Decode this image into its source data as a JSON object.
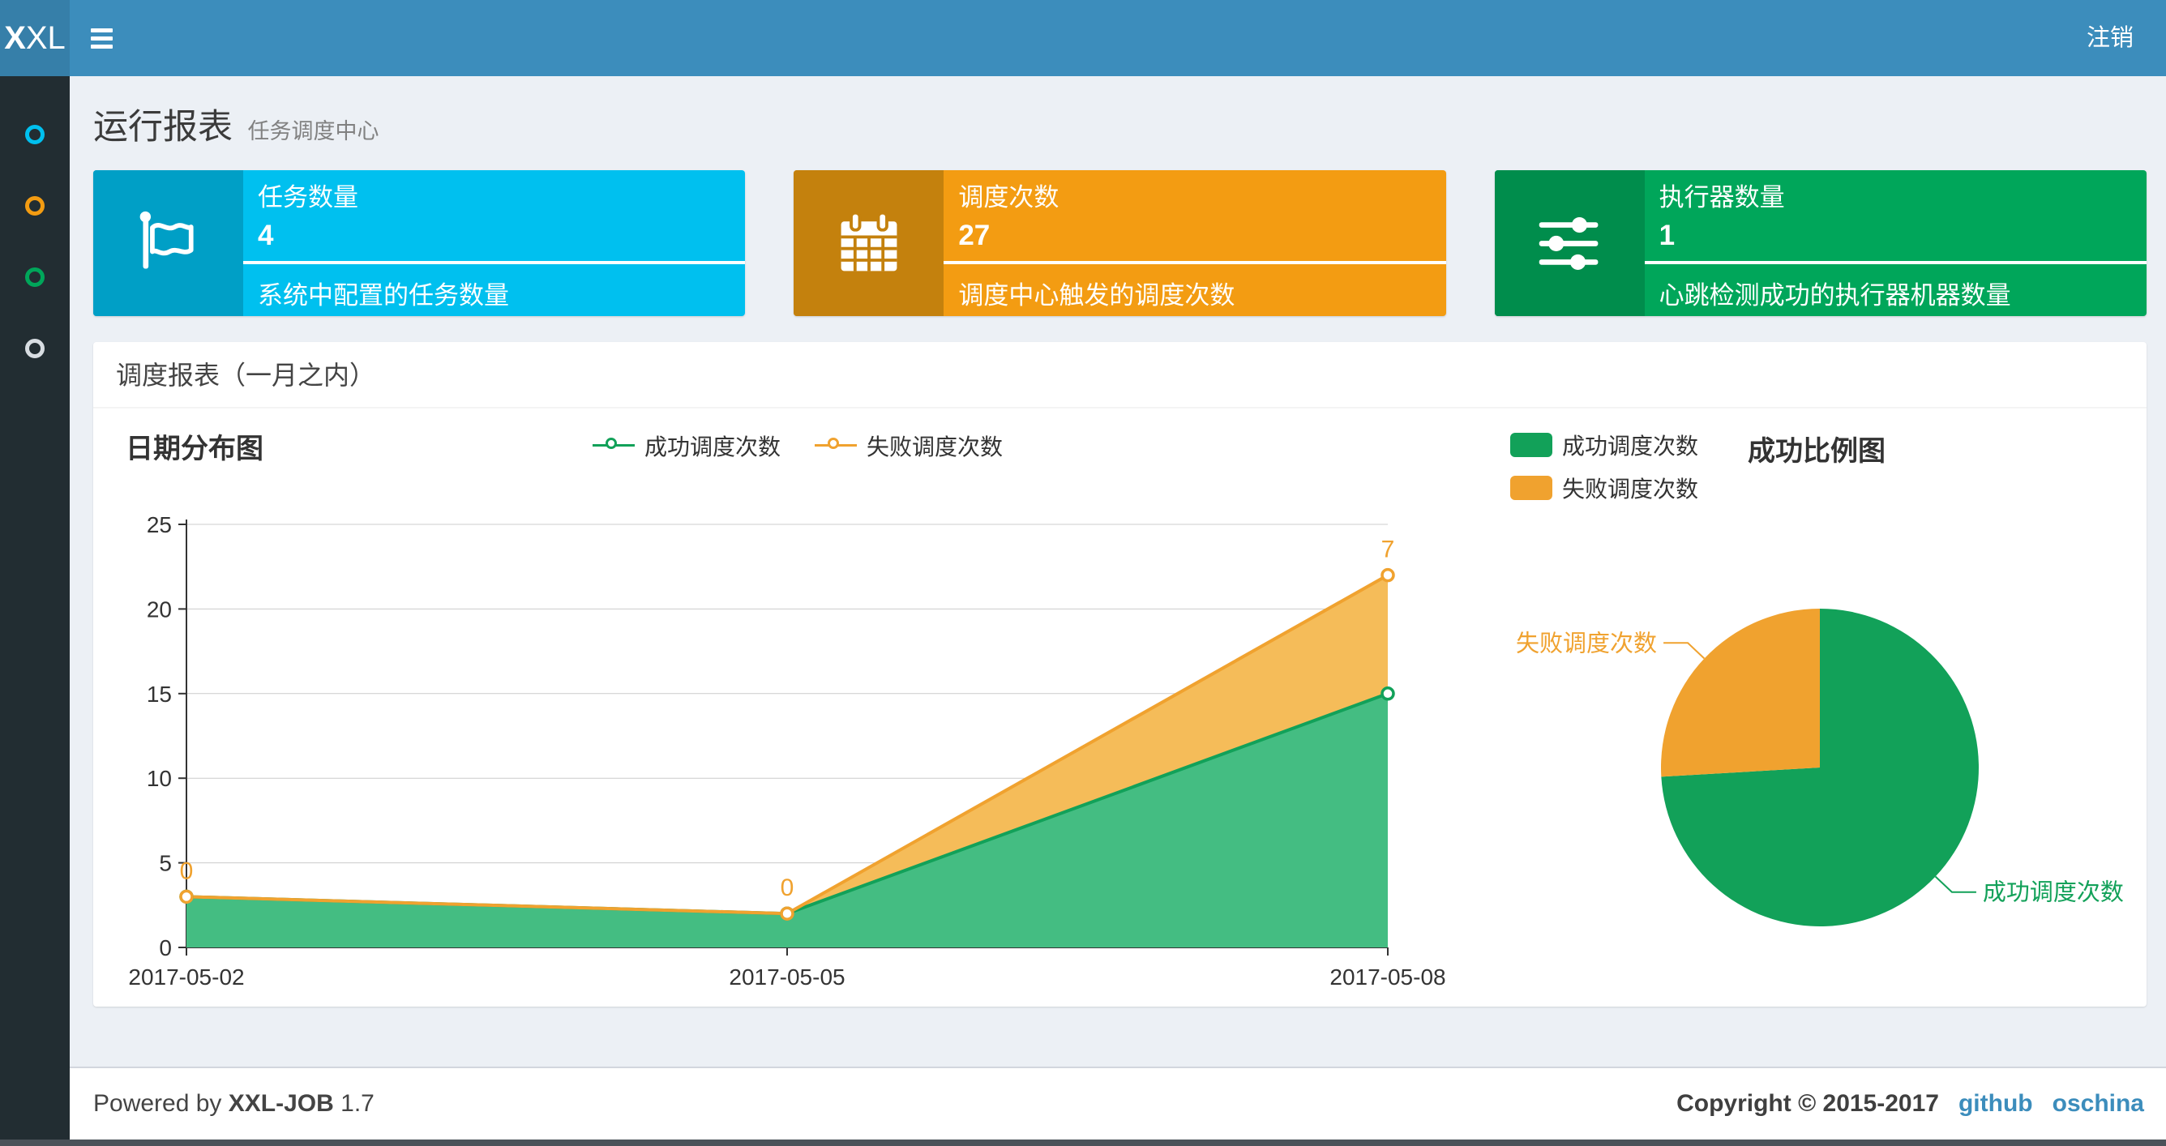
{
  "navbar": {
    "logo_bold": "X",
    "logo_light": "XL",
    "logout_label": "注销"
  },
  "sidebar": {
    "items": [
      {
        "icon": "circle-outline",
        "color": "#00c0ef"
      },
      {
        "icon": "circle-outline",
        "color": "#f39c12"
      },
      {
        "icon": "circle-outline",
        "color": "#00a65a"
      },
      {
        "icon": "circle-outline",
        "color": "#d8dde2"
      }
    ]
  },
  "page_header": {
    "title": "运行报表",
    "subtitle": "任务调度中心"
  },
  "info_boxes": [
    {
      "label": "任务数量",
      "value": "4",
      "desc": "系统中配置的任务数量",
      "icon": "flag",
      "bg": "#00c0ef",
      "icon_bg": "#009fc6"
    },
    {
      "label": "调度次数",
      "value": "27",
      "desc": "调度中心触发的调度次数",
      "icon": "calendar",
      "bg": "#f39c12",
      "icon_bg": "#c4810d"
    },
    {
      "label": "执行器数量",
      "value": "1",
      "desc": "心跳检测成功的执行器机器数量",
      "icon": "sliders",
      "bg": "#00a65a",
      "icon_bg": "#008d4c"
    }
  ],
  "panel": {
    "title": "调度报表（一月之内）"
  },
  "chart_data": [
    {
      "type": "area",
      "title": "日期分布图",
      "stacked": true,
      "grid": true,
      "legend_position": "top-center",
      "categories": [
        "2017-05-02",
        "2017-05-05",
        "2017-05-08"
      ],
      "ylim": [
        0,
        25
      ],
      "yticks": [
        0,
        5,
        10,
        15,
        20,
        25
      ],
      "series": [
        {
          "name": "成功调度次数",
          "values": [
            3,
            2,
            15
          ],
          "color": "#12a159",
          "fill": "#44bd82"
        },
        {
          "name": "失败调度次数",
          "values": [
            0,
            0,
            7
          ],
          "color": "#f0a22f",
          "fill": "#f5bc59",
          "point_labels": [
            "0",
            "0",
            "7"
          ]
        }
      ]
    },
    {
      "type": "pie",
      "title": "成功比例图",
      "legend_position": "top-left",
      "slices": [
        {
          "name": "成功调度次数",
          "value": 20,
          "color": "#12a159"
        },
        {
          "name": "失败调度次数",
          "value": 7,
          "color": "#f0a22f"
        }
      ]
    }
  ],
  "footer": {
    "powered_by": "Powered by",
    "product": "XXL-JOB",
    "version": "1.7",
    "copyright": "Copyright © 2015-2017",
    "links": [
      "github",
      "oschina"
    ]
  }
}
